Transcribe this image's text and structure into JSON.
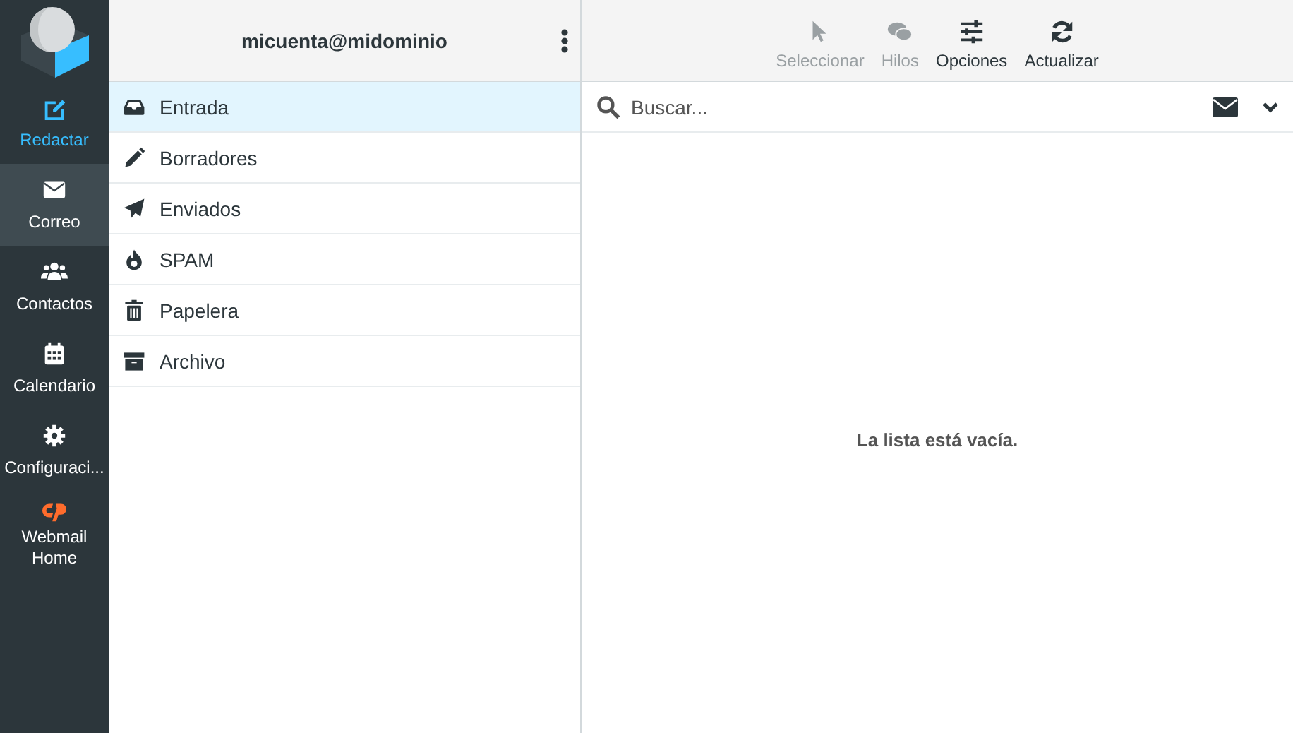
{
  "nav": [
    {
      "label": "Redactar",
      "kind": "compose",
      "selected": false
    },
    {
      "label": "Correo",
      "kind": "nav",
      "selected": true
    },
    {
      "label": "Contactos",
      "kind": "nav",
      "selected": false
    },
    {
      "label": "Calendario",
      "kind": "nav",
      "selected": false
    },
    {
      "label": "Configuraci...",
      "kind": "nav",
      "selected": false
    },
    {
      "label": "Webmail Home",
      "kind": "external",
      "selected": false
    }
  ],
  "account": {
    "title": "micuenta@midominio"
  },
  "folders": [
    {
      "label": "Entrada",
      "selected": true
    },
    {
      "label": "Borradores",
      "selected": false
    },
    {
      "label": "Enviados",
      "selected": false
    },
    {
      "label": "SPAM",
      "selected": false
    },
    {
      "label": "Papelera",
      "selected": false
    },
    {
      "label": "Archivo",
      "selected": false
    }
  ],
  "toolbar": [
    {
      "label": "Seleccionar",
      "disabled": true
    },
    {
      "label": "Hilos",
      "disabled": true
    },
    {
      "label": "Opciones",
      "disabled": false
    },
    {
      "label": "Actualizar",
      "disabled": false
    }
  ],
  "search": {
    "placeholder": "Buscar..."
  },
  "message_list": {
    "empty_text": "La lista está vacía."
  }
}
